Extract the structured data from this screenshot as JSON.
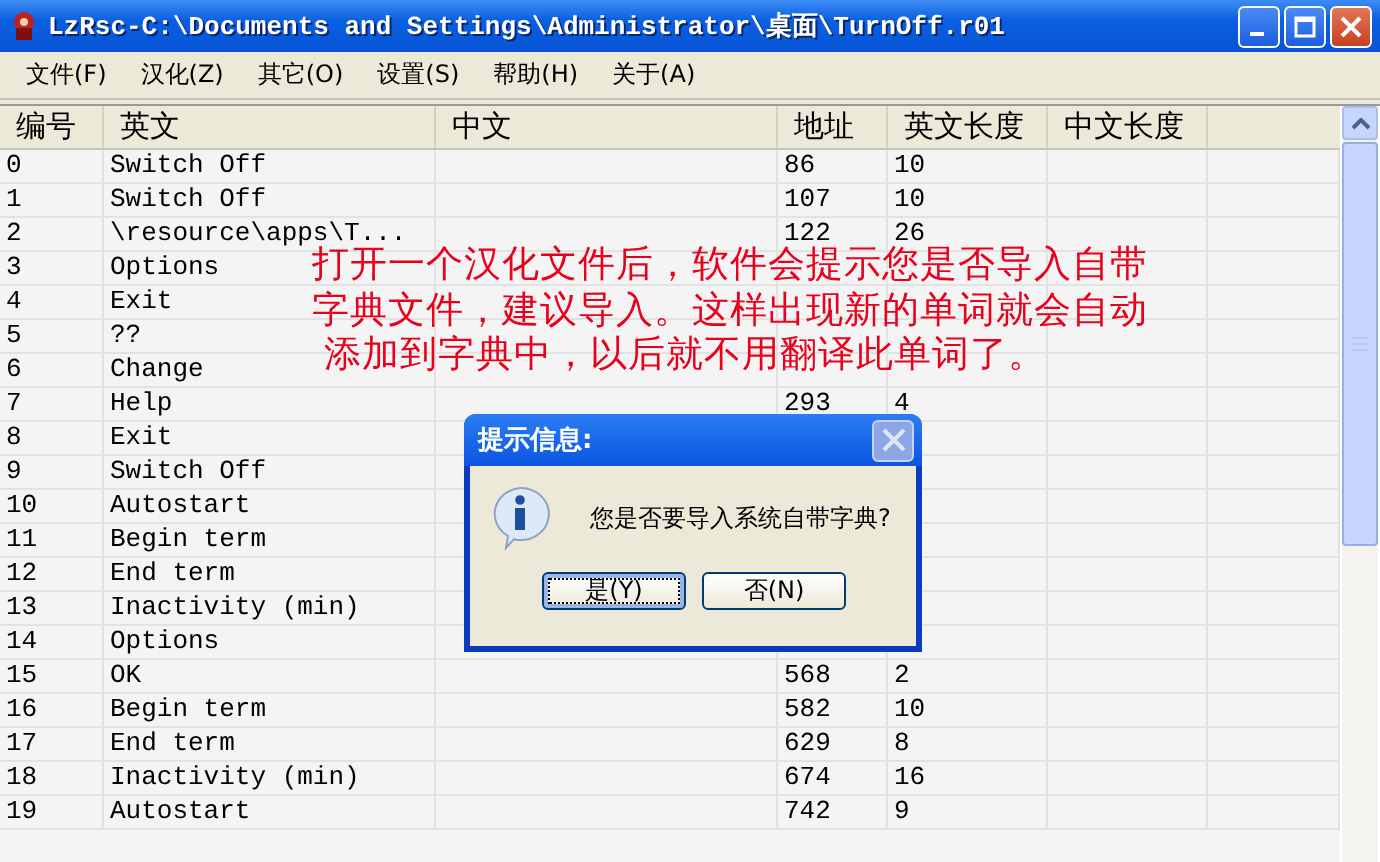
{
  "window": {
    "title": "LzRsc-C:\\Documents and Settings\\Administrator\\桌面\\TurnOff.r01"
  },
  "menu": [
    "文件(F)",
    "汉化(Z)",
    "其它(O)",
    "设置(S)",
    "帮助(H)",
    "关于(A)"
  ],
  "table": {
    "columns": [
      "编号",
      "英文",
      "中文",
      "地址",
      "英文长度",
      "中文长度"
    ],
    "rows": [
      {
        "id": "0",
        "english": "Switch Off",
        "address": "86",
        "en_length": "10"
      },
      {
        "id": "1",
        "english": "Switch Off",
        "address": "107",
        "en_length": "10"
      },
      {
        "id": "2",
        "english": "\\resource\\apps\\T...",
        "address": "122",
        "en_length": "26"
      },
      {
        "id": "3",
        "english": "Options"
      },
      {
        "id": "4",
        "english": "Exit"
      },
      {
        "id": "5",
        "english": "??"
      },
      {
        "id": "6",
        "english": "Change"
      },
      {
        "id": "7",
        "english": "Help",
        "address": "293",
        "en_length": "4"
      },
      {
        "id": "8",
        "english": "Exit"
      },
      {
        "id": "9",
        "english": "Switch Off"
      },
      {
        "id": "10",
        "english": "Autostart"
      },
      {
        "id": "11",
        "english": "Begin term"
      },
      {
        "id": "12",
        "english": "End term"
      },
      {
        "id": "13",
        "english": "Inactivity (min)"
      },
      {
        "id": "14",
        "english": "Options"
      },
      {
        "id": "15",
        "english": "OK",
        "address": "568",
        "en_length": "2"
      },
      {
        "id": "16",
        "english": "Begin term",
        "address": "582",
        "en_length": "10"
      },
      {
        "id": "17",
        "english": "End term",
        "address": "629",
        "en_length": "8"
      },
      {
        "id": "18",
        "english": "Inactivity (min)",
        "address": "674",
        "en_length": "16"
      },
      {
        "id": "19",
        "english": "Autostart",
        "address": "742",
        "en_length": "9"
      }
    ]
  },
  "annotation": [
    "打开一个汉化文件后，软件会提示您是否导入自带",
    "字典文件，建议导入。这样出现新的单词就会自动",
    " 添加到字典中，以后就不用翻译此单词了。"
  ],
  "dialog": {
    "title": "提示信息:",
    "message": "您是否要导入系统自带字典?",
    "buttons": [
      {
        "label": "是(Y)",
        "selected": true
      },
      {
        "label": "否(N)",
        "selected": false
      }
    ]
  }
}
